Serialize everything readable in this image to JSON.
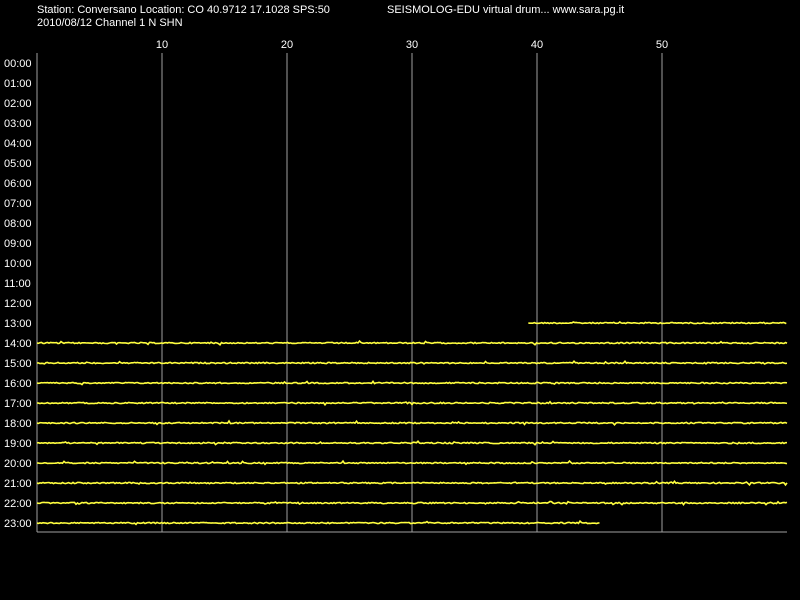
{
  "header": {
    "station_line": "Station: Conversano Location: CO 40.9712 17.1028 SPS:50",
    "app_line": "SEISMOLOG-EDU virtual drum... www.sara.pg.it",
    "date_channel_line": "2010/08/12  Channel 1 N SHN"
  },
  "colors": {
    "background": "#000000",
    "text": "#ffffff",
    "grid": "#a0a0a0",
    "trace": "#ffff40"
  },
  "chart_data": {
    "type": "line",
    "title": "",
    "xlabel": "",
    "ylabel": "",
    "x_unit_note": "minutes past the hour",
    "xlim": [
      0,
      60
    ],
    "x_ticks": [
      10,
      20,
      30,
      40,
      50
    ],
    "y_labels": [
      "00:00",
      "01:00",
      "02:00",
      "03:00",
      "04:00",
      "05:00",
      "06:00",
      "07:00",
      "08:00",
      "09:00",
      "10:00",
      "11:00",
      "12:00",
      "13:00",
      "14:00",
      "15:00",
      "16:00",
      "17:00",
      "18:00",
      "19:00",
      "20:00",
      "21:00",
      "22:00",
      "23:00"
    ],
    "grid": true,
    "series": [
      {
        "hour": "13:00",
        "start_min": 39.3,
        "end_min": 60
      },
      {
        "hour": "14:00",
        "start_min": 0,
        "end_min": 60
      },
      {
        "hour": "15:00",
        "start_min": 0,
        "end_min": 60
      },
      {
        "hour": "16:00",
        "start_min": 0,
        "end_min": 60
      },
      {
        "hour": "17:00",
        "start_min": 0,
        "end_min": 60
      },
      {
        "hour": "18:00",
        "start_min": 0,
        "end_min": 60
      },
      {
        "hour": "19:00",
        "start_min": 0,
        "end_min": 60
      },
      {
        "hour": "20:00",
        "start_min": 0,
        "end_min": 60
      },
      {
        "hour": "21:00",
        "start_min": 0,
        "end_min": 60
      },
      {
        "hour": "22:00",
        "start_min": 0,
        "end_min": 60
      },
      {
        "hour": "23:00",
        "start_min": 0,
        "end_min": 45
      }
    ]
  }
}
